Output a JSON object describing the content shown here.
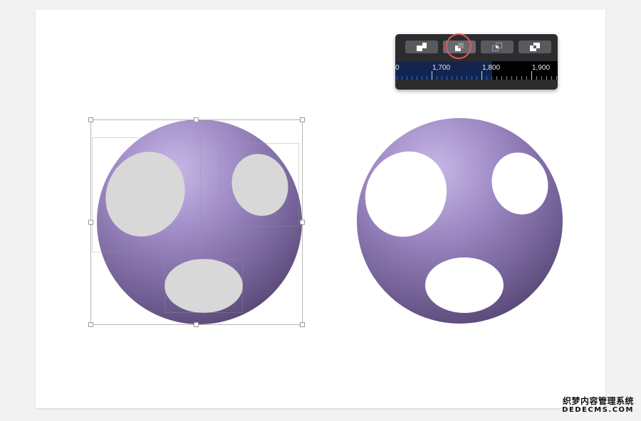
{
  "toolbar": {
    "buttons": [
      {
        "name": "union-button",
        "icon": "union-icon",
        "selected": false
      },
      {
        "name": "subtract-button",
        "icon": "subtract-icon",
        "selected": true
      },
      {
        "name": "intersect-button",
        "icon": "intersect-icon",
        "selected": false
      },
      {
        "name": "exclude-button",
        "icon": "exclude-icon",
        "selected": false
      }
    ],
    "ruler": {
      "labels": [
        "0",
        "1,700",
        "1,800",
        "1,900"
      ]
    }
  },
  "colors": {
    "sphere_light": "#c7b8e8",
    "sphere_dark": "#3d2f55",
    "hole_grey": "#d8d8d8",
    "ring": "#e05a5a"
  },
  "watermark": {
    "line1": "织梦内容管理系统",
    "line2": "DEDECMS.COM"
  }
}
